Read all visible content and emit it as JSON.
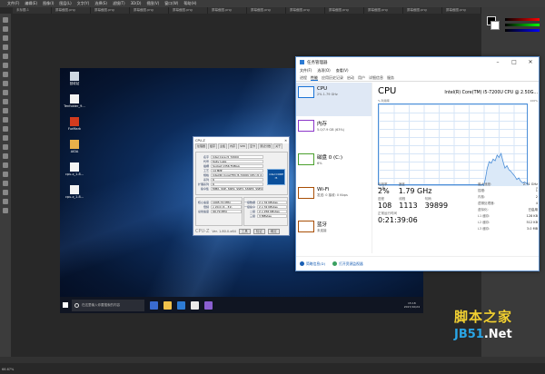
{
  "photoshop": {
    "menu": [
      "文件(F)",
      "编辑(E)",
      "图像(I)",
      "图层(L)",
      "文字(Y)",
      "选择(S)",
      "滤镜(T)",
      "3D(D)",
      "视图(V)",
      "窗口(W)",
      "帮助(H)"
    ],
    "doc_tabs": [
      "未标题-1",
      "屏幕截图.png",
      "屏幕截图.png",
      "屏幕截图.png",
      "屏幕截图.png",
      "屏幕截图.png",
      "屏幕截图.png",
      "屏幕截图.png",
      "屏幕截图.png",
      "屏幕截图.png",
      "屏幕截图.png",
      "屏幕截图.png"
    ],
    "status_zoom": "66.67%"
  },
  "desktop": {
    "icons": [
      {
        "label": "回收站",
        "color": "#cfd8e3"
      },
      {
        "label": "Tenfolder_9...",
        "color": "#f3f3f3"
      },
      {
        "label": "FurMark",
        "color": "#d23b1e"
      },
      {
        "label": "AIDA",
        "color": "#e8b04a"
      },
      {
        "label": "cpu-z_1.8...",
        "color": "#f3f3f3"
      },
      {
        "label": "cpu-z_1.8...",
        "color": "#f3f3f3"
      }
    ],
    "taskbar": {
      "search_placeholder": "在这里输入你要搜索的内容",
      "time": "15:18",
      "date": "2017/10/24",
      "apps": [
        "#3a6bd0",
        "#f0c14b",
        "#2d7bd4",
        "#eaeaea",
        "#8a5fd0"
      ]
    }
  },
  "cpuz": {
    "title": "CPU-Z",
    "tabs": [
      "处理器",
      "缓存",
      "主板",
      "内存",
      "SPD",
      "显卡",
      "测试分数",
      "关于"
    ],
    "rows": [
      {
        "label": "名字",
        "value": "Intel Core i5 7200U"
      },
      {
        "label": "代号",
        "value": "Kaby Lake"
      },
      {
        "label": "插槽",
        "value": "Socket 1356 FCBGA"
      },
      {
        "label": "工艺",
        "value": "14 纳米"
      },
      {
        "label": "规格",
        "value": "Intel(R) Core(TM) i5-7200U CPU @ 2.50GHz"
      },
      {
        "label": "系列",
        "value": "6"
      },
      {
        "label": "扩展系列",
        "value": "6"
      },
      {
        "label": "指令集",
        "value": "MMX, SSE, SSE2, SSE3, SSSE3, SSE4.1, SSE4.2, EM64T, VT-x, AES, AVX, AVX2, FMA3"
      }
    ],
    "clock_rows": [
      {
        "label": "核心速度",
        "value": "1995.72 MHz"
      },
      {
        "label": "倍频",
        "value": "x 20.0 (4 - 31)"
      },
      {
        "label": "总线速度",
        "value": "99.79 MHz"
      }
    ],
    "cache_rows": [
      {
        "label": "一级数据",
        "value": "2 x 32 KBytes"
      },
      {
        "label": "一级指令",
        "value": "2 x 32 KBytes"
      },
      {
        "label": "二级",
        "value": "2 x 256 KBytes"
      },
      {
        "label": "三级",
        "value": "3 MBytes"
      }
    ],
    "footer_brand": "CPU-Z",
    "footer_version": "Ver. 1.80.0.x64",
    "btn_tools": "工具",
    "btn_verify": "验证",
    "btn_ok": "确定",
    "intel_text": "intel CORE i5"
  },
  "taskmgr": {
    "title": "任务管理器",
    "menu": [
      "文件(F)",
      "选项(O)",
      "查看(V)"
    ],
    "tabs": [
      "进程",
      "性能",
      "应用历史记录",
      "启动",
      "用户",
      "详细信息",
      "服务"
    ],
    "active_tab": "性能",
    "sidebar": [
      {
        "name": "CPU",
        "detail": "2% 1.79 GHz",
        "color": "#1a73d6",
        "selected": true
      },
      {
        "name": "内存",
        "detail": "5.0/7.9 GB (63%)",
        "color": "#8b36c9",
        "selected": false
      },
      {
        "name": "磁盘 0 (C:)",
        "detail": "6%",
        "color": "#4aa02c",
        "selected": false
      },
      {
        "name": "Wi-Fi",
        "detail": "发送: 0 接收: 0 Kbps",
        "color": "#a84e05",
        "selected": false
      },
      {
        "name": "蓝牙",
        "detail": "未连接",
        "color": "#a84e05",
        "selected": false
      }
    ],
    "main": {
      "title": "CPU",
      "model": "Intel(R) Core(TM) i5-7200U CPU @ 2.50G...",
      "graph_top_left": "% 利用率",
      "graph_top_right": "100%",
      "graph_bottom_left": "60 秒",
      "graph_bottom_right": "0",
      "graph_values": [
        0,
        0,
        0,
        0,
        0,
        0,
        0,
        0,
        0,
        0,
        0,
        0,
        0,
        0,
        0,
        0,
        0,
        0,
        0,
        0,
        0,
        0,
        0,
        0,
        0,
        0,
        0,
        0,
        0,
        0,
        0,
        0,
        0,
        0,
        0,
        0,
        0,
        0,
        0,
        0,
        0,
        0,
        0,
        0,
        0,
        0,
        0,
        0,
        0,
        0,
        0,
        0,
        0,
        0,
        8,
        22,
        30,
        28,
        33,
        31,
        38,
        35,
        40,
        30,
        22,
        25,
        20,
        18,
        15,
        12,
        8,
        10,
        6,
        4,
        5,
        3,
        2
      ]
    },
    "stats": {
      "util_label": "利用率",
      "util": "2%",
      "speed_label": "速度",
      "speed": "1.79 GHz",
      "proc_label": "进程",
      "proc": "108",
      "thread_label": "线程",
      "thread": "1113",
      "handle_label": "句柄",
      "handle": "39899",
      "uptime_label": "正常运行时间",
      "uptime": "0:21:39:06"
    },
    "specs": [
      {
        "k": "最大速度:",
        "v": "2.71 GHz"
      },
      {
        "k": "插槽:",
        "v": "1"
      },
      {
        "k": "内核:",
        "v": "2"
      },
      {
        "k": "逻辑处理器:",
        "v": "4"
      },
      {
        "k": "虚拟化:",
        "v": "已启用"
      },
      {
        "k": "L1 缓存:",
        "v": "128 KB"
      },
      {
        "k": "L2 缓存:",
        "v": "512 KB"
      },
      {
        "k": "L3 缓存:",
        "v": "3.0 MB"
      }
    ],
    "footer_less": "简略信息(D)",
    "footer_monitor": "打开资源监视器"
  },
  "watermark": {
    "line1": "脚本之家",
    "line2a": "JB51",
    "line2b": ".Net"
  }
}
